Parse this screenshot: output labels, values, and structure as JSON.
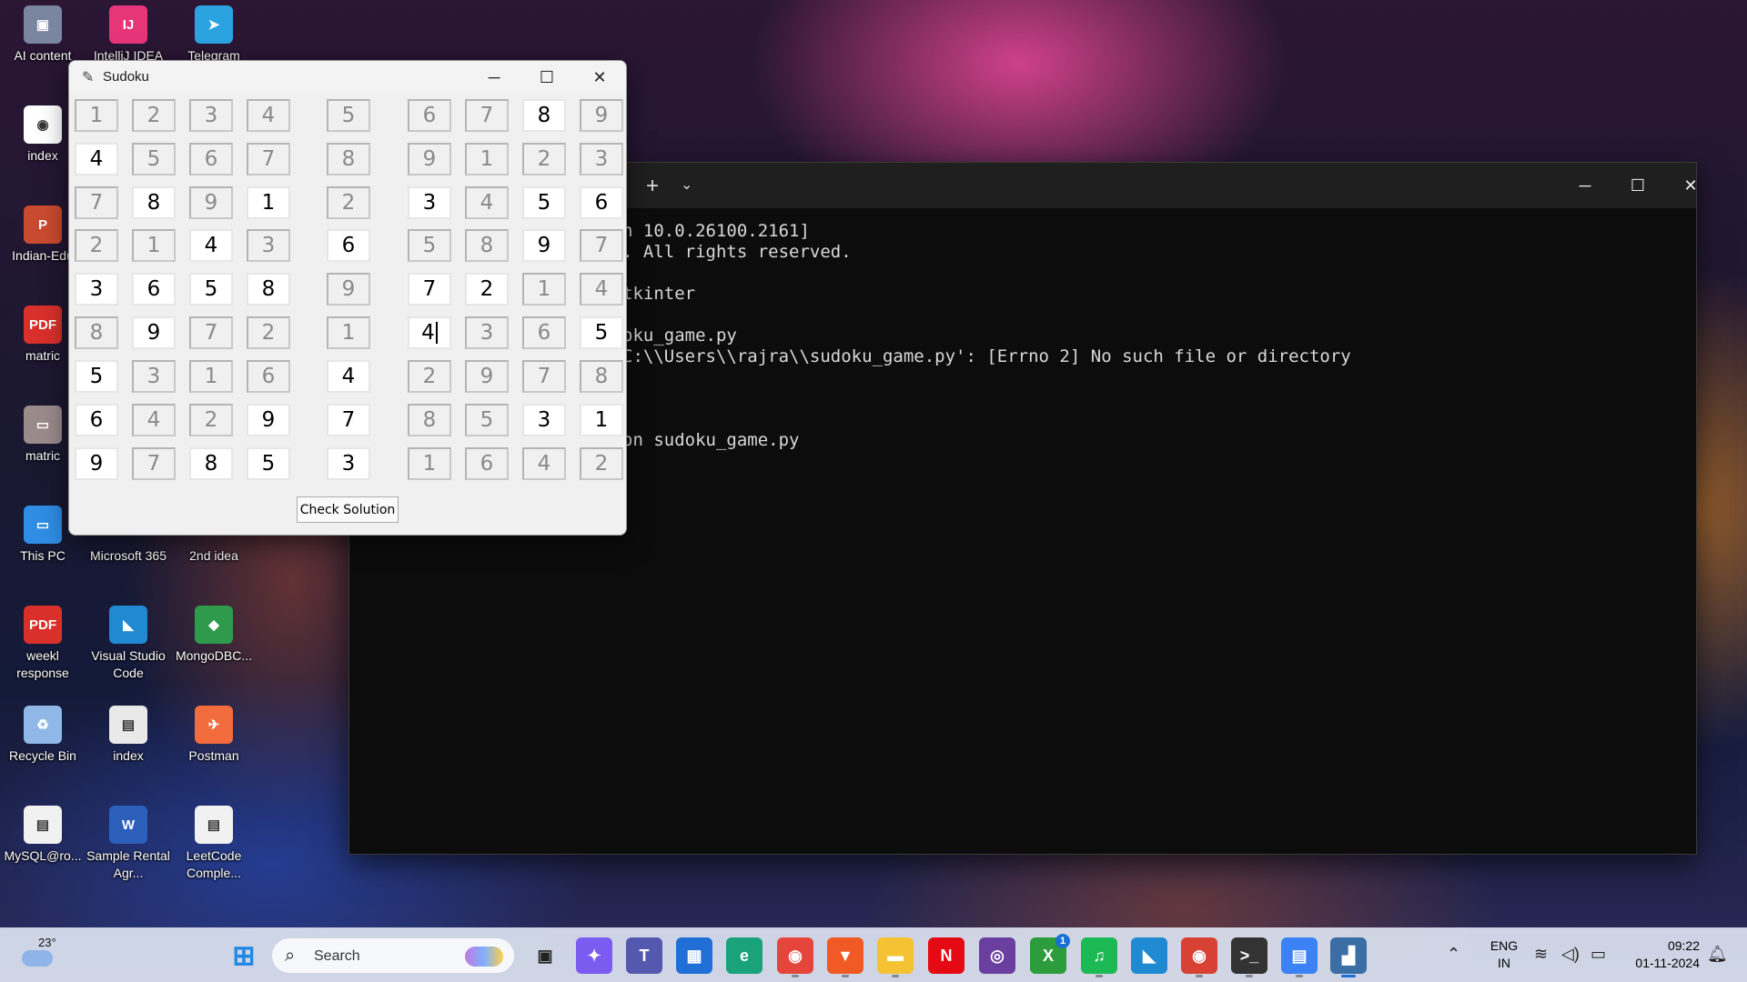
{
  "desktop": {
    "icons": [
      {
        "label": "AI content",
        "glyph": "▣",
        "color": "#7a86a0"
      },
      {
        "label": "IntelliJ IDEA",
        "glyph": "IJ",
        "color": "#e7357a"
      },
      {
        "label": "Telegram",
        "glyph": "➤",
        "color": "#2aa3e0"
      },
      {
        "label": "index",
        "glyph": "◉",
        "color": "#ffffff"
      },
      {
        "label": "Indian-Edu",
        "glyph": "P",
        "color": "#c94b2f"
      },
      {
        "label": "matric",
        "glyph": "PDF",
        "color": "#d9302b"
      },
      {
        "label": "matric",
        "glyph": "▭",
        "color": "#9a8b8b"
      },
      {
        "label": "This PC",
        "glyph": "▭",
        "color": "#2f8de4"
      },
      {
        "label": "Microsoft 365",
        "glyph": "",
        "color": "transparent"
      },
      {
        "label": "2nd idea",
        "glyph": "",
        "color": "transparent"
      },
      {
        "label": "weekl response",
        "glyph": "PDF",
        "color": "#d9302b"
      },
      {
        "label": "Visual Studio Code",
        "glyph": "◣",
        "color": "#1f8ad2"
      },
      {
        "label": "MongoDBC...",
        "glyph": "◆",
        "color": "#2f9a4b"
      },
      {
        "label": "Recycle Bin",
        "glyph": "♻",
        "color": "#8fb8e8"
      },
      {
        "label": "index",
        "glyph": "▤",
        "color": "#e9e9e9"
      },
      {
        "label": "Postman",
        "glyph": "✈",
        "color": "#f36c3d"
      },
      {
        "label": "MySQL@ro...",
        "glyph": "▤",
        "color": "#f1f1f1"
      },
      {
        "label": "Sample Rental Agr...",
        "glyph": "W",
        "color": "#2b5fb9"
      },
      {
        "label": "LeetCode Comple...",
        "glyph": "▤",
        "color": "#f1f1f1"
      }
    ]
  },
  "terminal": {
    "lines": [
      "n 10.0.26100.2161]",
      ". All rights reserved.",
      "",
      "tkinter",
      "",
      "oku_game.py",
      "C:\\\\Users\\\\rajra\\\\sudoku_game.py': [Errno 2] No such file or directory",
      "",
      "",
      "",
      "on sudoku_game.py"
    ],
    "add_tab": "+",
    "tab_menu": "⌄",
    "minimize": "─",
    "maximize": "☐",
    "close": "✕"
  },
  "sudoku": {
    "title": "Sudoku",
    "minimize": "─",
    "maximize": "☐",
    "close": "✕",
    "check_button": "Check Solution",
    "grid": [
      [
        "1",
        "2",
        "3",
        "4",
        "5",
        "6",
        "7",
        "8",
        "9"
      ],
      [
        "4",
        "5",
        "6",
        "7",
        "8",
        "9",
        "1",
        "2",
        "3"
      ],
      [
        "7",
        "8",
        "9",
        "1",
        "2",
        "3",
        "4",
        "5",
        "6"
      ],
      [
        "2",
        "1",
        "4",
        "3",
        "6",
        "5",
        "8",
        "9",
        "7"
      ],
      [
        "3",
        "6",
        "5",
        "8",
        "9",
        "7",
        "2",
        "1",
        "4"
      ],
      [
        "8",
        "9",
        "7",
        "2",
        "1",
        "4",
        "3",
        "6",
        "5"
      ],
      [
        "5",
        "3",
        "1",
        "6",
        "4",
        "2",
        "9",
        "7",
        "8"
      ],
      [
        "6",
        "4",
        "2",
        "9",
        "7",
        "8",
        "5",
        "3",
        "1"
      ],
      [
        "9",
        "7",
        "8",
        "5",
        "3",
        "1",
        "6",
        "4",
        "2"
      ]
    ],
    "entries": [
      [
        0,
        0,
        0,
        0,
        0,
        0,
        0,
        1,
        0
      ],
      [
        1,
        0,
        0,
        0,
        0,
        0,
        0,
        0,
        0
      ],
      [
        0,
        1,
        0,
        1,
        0,
        1,
        0,
        1,
        1
      ],
      [
        0,
        0,
        1,
        0,
        1,
        0,
        0,
        1,
        0
      ],
      [
        1,
        1,
        1,
        1,
        0,
        1,
        1,
        0,
        0
      ],
      [
        0,
        1,
        0,
        0,
        0,
        1,
        0,
        0,
        1
      ],
      [
        1,
        0,
        0,
        0,
        1,
        0,
        0,
        0,
        0
      ],
      [
        1,
        0,
        0,
        1,
        1,
        0,
        0,
        1,
        1
      ],
      [
        1,
        0,
        1,
        1,
        1,
        0,
        0,
        0,
        0
      ]
    ],
    "active_cell": [
      5,
      5
    ]
  },
  "taskbar": {
    "weather_temp": "23°",
    "search_placeholder": "Search",
    "apps": [
      {
        "name": "start",
        "glyph": "⊞",
        "color": "#1e88e5"
      },
      {
        "name": "task-view",
        "glyph": "▣",
        "color": "#222222"
      },
      {
        "name": "copilot",
        "glyph": "✦",
        "color": "#7c5cf0"
      },
      {
        "name": "teams",
        "glyph": "T",
        "color": "#5558af"
      },
      {
        "name": "store",
        "glyph": "▦",
        "color": "#1f6fd6"
      },
      {
        "name": "edge",
        "glyph": "e",
        "color": "#1aa27a"
      },
      {
        "name": "chrome",
        "glyph": "◉",
        "color": "#e5453a"
      },
      {
        "name": "brave",
        "glyph": "▼",
        "color": "#f15a24"
      },
      {
        "name": "explorer",
        "glyph": "▬",
        "color": "#f4c233"
      },
      {
        "name": "netflix",
        "glyph": "N",
        "color": "#e50914"
      },
      {
        "name": "media",
        "glyph": "◎",
        "color": "#6b3fa0"
      },
      {
        "name": "xbox",
        "glyph": "X",
        "color": "#2d9c3c"
      },
      {
        "name": "spotify",
        "glyph": "♫",
        "color": "#1db954"
      },
      {
        "name": "vscode",
        "glyph": "◣",
        "color": "#1f8ad2"
      },
      {
        "name": "chrome-profile",
        "glyph": "◉",
        "color": "#d74235"
      },
      {
        "name": "terminal",
        "glyph": ">_",
        "color": "#333333"
      },
      {
        "name": "notepad",
        "glyph": "▤",
        "color": "#3b82f6"
      },
      {
        "name": "python",
        "glyph": "▟",
        "color": "#3a6ea5"
      }
    ],
    "language": [
      "ENG",
      "IN"
    ],
    "time": "09:22",
    "date": "01-11-2024",
    "xbox_badge": "1"
  }
}
